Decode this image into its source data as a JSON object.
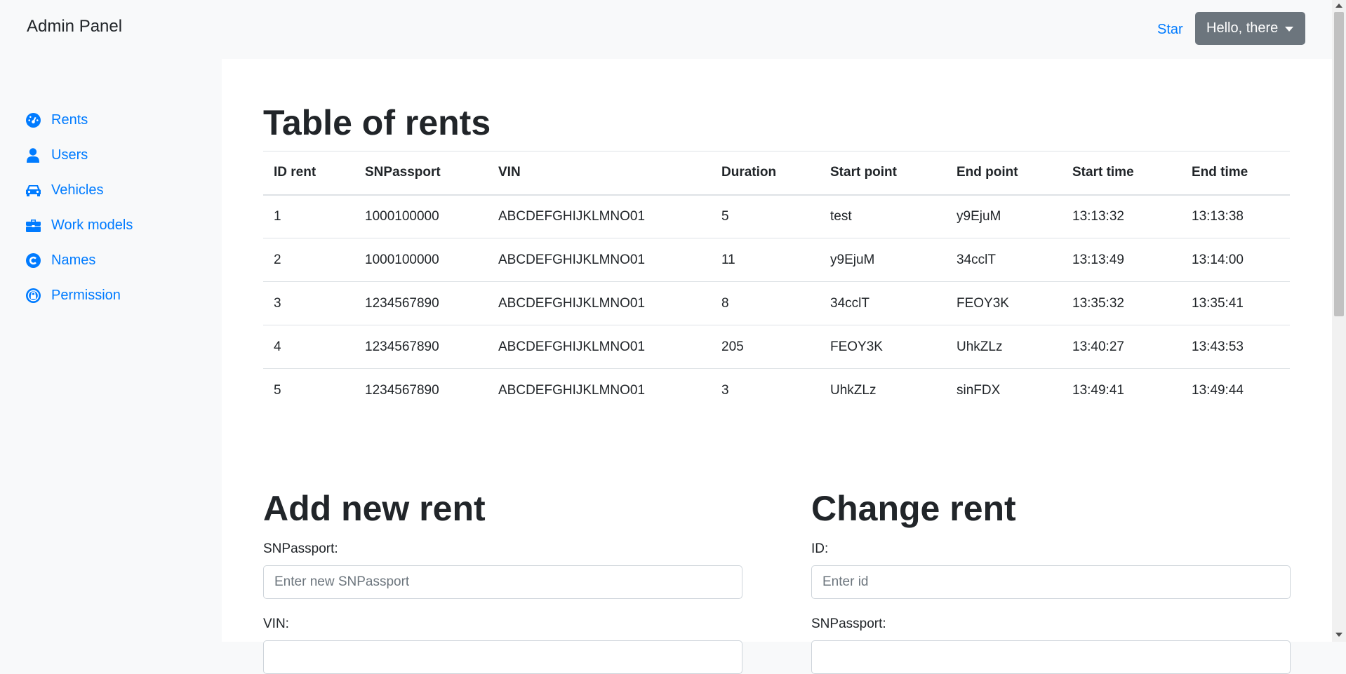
{
  "navbar": {
    "brand": "Admin Panel",
    "star_link": "Star",
    "user_menu": "Hello, there"
  },
  "sidebar": {
    "items": [
      {
        "label": "Rents",
        "icon": "tachometer-icon"
      },
      {
        "label": "Users",
        "icon": "user-icon"
      },
      {
        "label": "Vehicles",
        "icon": "car-icon"
      },
      {
        "label": "Work models",
        "icon": "briefcase-icon"
      },
      {
        "label": "Names",
        "icon": "copyright-icon"
      },
      {
        "label": "Permission",
        "icon": "lock-icon"
      }
    ]
  },
  "main": {
    "table_title": "Table of rents",
    "table": {
      "headers": [
        "ID rent",
        "SNPassport",
        "VIN",
        "Duration",
        "Start point",
        "End point",
        "Start time",
        "End time"
      ],
      "rows": [
        [
          "1",
          "1000100000",
          "ABCDEFGHIJKLMNO01",
          "5",
          "test",
          "y9EjuM",
          "13:13:32",
          "13:13:38"
        ],
        [
          "2",
          "1000100000",
          "ABCDEFGHIJKLMNO01",
          "11",
          "y9EjuM",
          "34cclT",
          "13:13:49",
          "13:14:00"
        ],
        [
          "3",
          "1234567890",
          "ABCDEFGHIJKLMNO01",
          "8",
          "34cclT",
          "FEOY3K",
          "13:35:32",
          "13:35:41"
        ],
        [
          "4",
          "1234567890",
          "ABCDEFGHIJKLMNO01",
          "205",
          "FEOY3K",
          "UhkZLz",
          "13:40:27",
          "13:43:53"
        ],
        [
          "5",
          "1234567890",
          "ABCDEFGHIJKLMNO01",
          "3",
          "UhkZLz",
          "sinFDX",
          "13:49:41",
          "13:49:44"
        ]
      ]
    },
    "add_form": {
      "title": "Add new rent",
      "snpassport_label": "SNPassport:",
      "snpassport_placeholder": "Enter new SNPassport",
      "vin_label": "VIN:"
    },
    "change_form": {
      "title": "Change rent",
      "id_label": "ID:",
      "id_placeholder": "Enter id",
      "snpassport_label": "SNPassport:"
    }
  },
  "colors": {
    "link": "#007bff",
    "button_secondary": "#6c757d",
    "background": "#f8f9fa"
  }
}
